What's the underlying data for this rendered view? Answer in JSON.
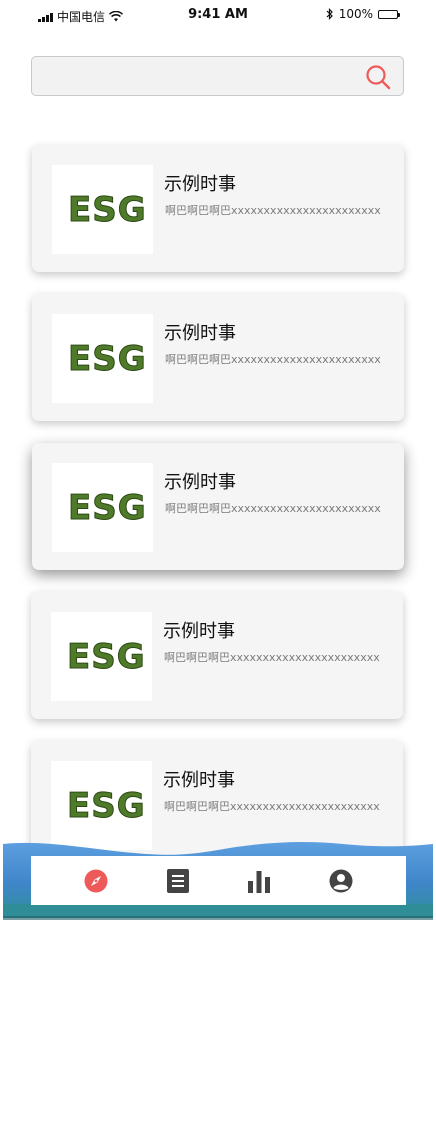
{
  "status_bar": {
    "carrier": "中国电信",
    "time": "9:41 AM",
    "battery": "100%"
  },
  "search": {
    "value": "",
    "placeholder": ""
  },
  "news_items": [
    {
      "title": "示例时事",
      "desc": "啊巴啊巴啊巴xxxxxxxxxxxxxxxxxxxxxxx",
      "image_text": "ESG"
    },
    {
      "title": "示例时事",
      "desc": "啊巴啊巴啊巴xxxxxxxxxxxxxxxxxxxxxxx",
      "image_text": "ESG"
    },
    {
      "title": "示例时事",
      "desc": "啊巴啊巴啊巴xxxxxxxxxxxxxxxxxxxxxxx",
      "image_text": "ESG"
    },
    {
      "title": "示例时事",
      "desc": "啊巴啊巴啊巴xxxxxxxxxxxxxxxxxxxxxxx",
      "image_text": "ESG"
    },
    {
      "title": "示例时事",
      "desc": "啊巴啊巴啊巴xxxxxxxxxxxxxxxxxxxxxxx",
      "image_text": "ESG"
    }
  ],
  "bottom_nav": {
    "items": [
      {
        "icon": "compass-icon",
        "active": true
      },
      {
        "icon": "article-list-icon",
        "active": false
      },
      {
        "icon": "bar-chart-icon",
        "active": false
      },
      {
        "icon": "account-circle-icon",
        "active": false
      }
    ]
  },
  "colors": {
    "accent": "#ee5a5a",
    "icon_inactive": "#444444",
    "card_bg": "#f5f5f5",
    "search_bg": "#f2f2f2",
    "wave_blue": "#4a90d9",
    "wave_teal": "#2f8f9a",
    "esg_green": "#4f7a2a"
  }
}
